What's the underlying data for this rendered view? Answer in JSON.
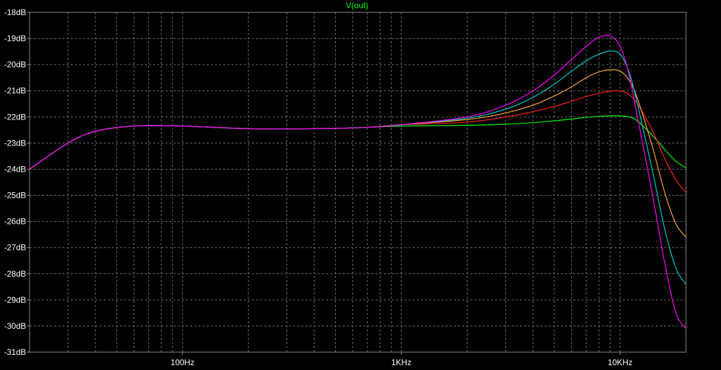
{
  "chart_data": {
    "type": "line",
    "title": "V(out)",
    "xlabel": "",
    "ylabel": "",
    "x_scale": "log",
    "xlim": [
      20,
      20000
    ],
    "ylim": [
      -31,
      -18
    ],
    "y_unit": "dB",
    "grid": true,
    "y_ticks": [
      "-18dB",
      "-19dB",
      "-20dB",
      "-21dB",
      "-22dB",
      "-23dB",
      "-24dB",
      "-25dB",
      "-26dB",
      "-27dB",
      "-28dB",
      "-29dB",
      "-30dB",
      "-31dB"
    ],
    "y_tick_values": [
      -18,
      -19,
      -20,
      -21,
      -22,
      -23,
      -24,
      -25,
      -26,
      -27,
      -28,
      -29,
      -30,
      -31
    ],
    "x_ticks": [
      "100Hz",
      "1KHz",
      "10KHz"
    ],
    "x_tick_values": [
      100,
      1000,
      10000
    ],
    "x": [
      20,
      30,
      40,
      60,
      100,
      200,
      400,
      700,
      1000,
      2000,
      3000,
      4000,
      5000,
      6000,
      7000,
      8000,
      9000,
      10000,
      11000,
      12000,
      14000,
      16000,
      18000,
      20000
    ],
    "series": [
      {
        "color": "#ff00ff",
        "values": [
          -24.0,
          -23.0,
          -22.55,
          -22.35,
          -22.35,
          -22.45,
          -22.45,
          -22.4,
          -22.3,
          -22.0,
          -21.55,
          -21.0,
          -20.4,
          -19.8,
          -19.3,
          -18.95,
          -18.9,
          -19.3,
          -20.4,
          -22.0,
          -24.9,
          -27.6,
          -29.5,
          -30.1
        ]
      },
      {
        "color": "#00cccc",
        "values": [
          -24.0,
          -23.0,
          -22.55,
          -22.35,
          -22.35,
          -22.45,
          -22.45,
          -22.4,
          -22.3,
          -22.05,
          -21.7,
          -21.25,
          -20.75,
          -20.25,
          -19.85,
          -19.6,
          -19.48,
          -19.6,
          -20.3,
          -21.5,
          -24.0,
          -26.3,
          -27.8,
          -28.4
        ]
      },
      {
        "color": "#ffaa33",
        "values": [
          -24.0,
          -23.0,
          -22.55,
          -22.35,
          -22.35,
          -22.45,
          -22.45,
          -22.4,
          -22.3,
          -22.1,
          -21.85,
          -21.55,
          -21.2,
          -20.85,
          -20.5,
          -20.28,
          -20.2,
          -20.25,
          -20.6,
          -21.3,
          -23.1,
          -24.9,
          -26.1,
          -26.6
        ]
      },
      {
        "color": "#ff2020",
        "values": [
          -24.0,
          -23.0,
          -22.55,
          -22.35,
          -22.35,
          -22.45,
          -22.45,
          -22.4,
          -22.3,
          -22.2,
          -22.0,
          -21.8,
          -21.6,
          -21.4,
          -21.22,
          -21.1,
          -21.02,
          -21.0,
          -21.15,
          -21.5,
          -22.5,
          -23.6,
          -24.4,
          -24.9
        ]
      },
      {
        "color": "#00ff00",
        "values": [
          -24.0,
          -23.0,
          -22.55,
          -22.35,
          -22.35,
          -22.45,
          -22.45,
          -22.4,
          -22.35,
          -22.32,
          -22.28,
          -22.22,
          -22.15,
          -22.08,
          -22.02,
          -21.98,
          -21.96,
          -21.96,
          -22.0,
          -22.15,
          -22.7,
          -23.25,
          -23.7,
          -23.95
        ]
      }
    ]
  }
}
